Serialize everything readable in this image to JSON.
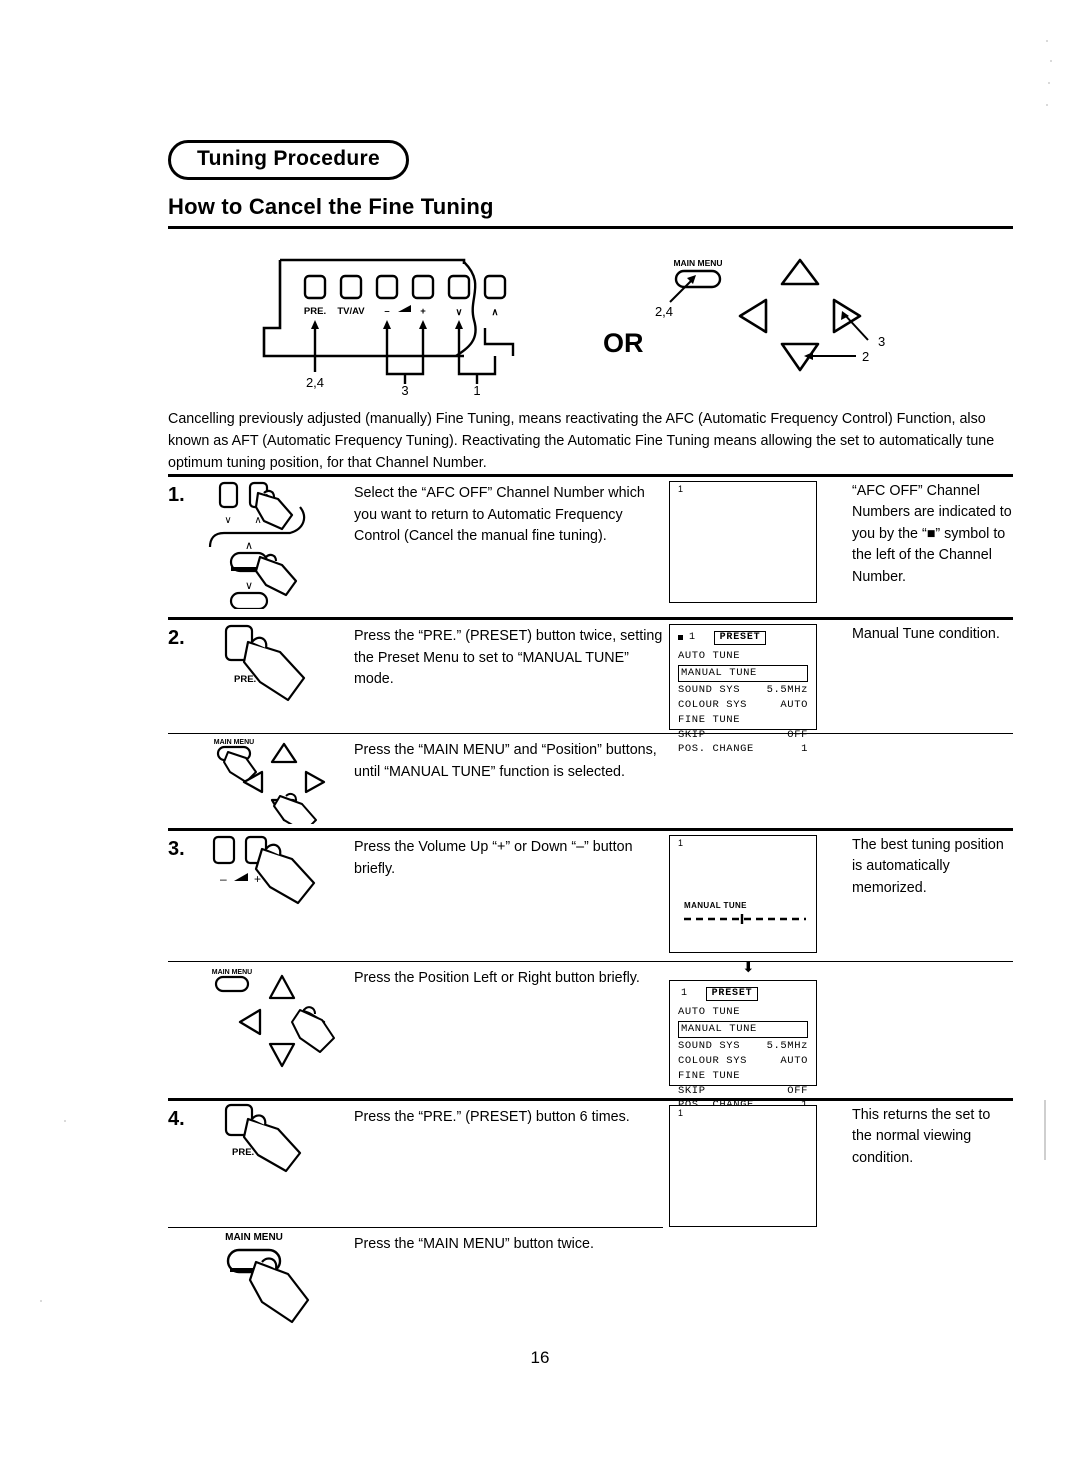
{
  "header": {
    "badge_label": "Tuning Procedure",
    "subtitle": "How to Cancel the Fine Tuning"
  },
  "top_diagram": {
    "tv_panel": {
      "button_labels": [
        "PRE.",
        "TV/AV",
        "–",
        "+",
        "∨",
        "∧"
      ],
      "volume_icon": "volume-wedge-icon",
      "callouts": [
        {
          "label": "2,4",
          "target": "PRE."
        },
        {
          "label": "3",
          "target": "volume - / +"
        },
        {
          "label": "1",
          "target": "channel down / up"
        }
      ]
    },
    "or_label": "OR",
    "remote": {
      "main_menu_label": "MAIN MENU",
      "callouts": [
        {
          "label": "2,4",
          "target": "MAIN MENU button"
        },
        {
          "label": "3",
          "target": "position right button"
        },
        {
          "label": "2",
          "target": "position down button"
        }
      ]
    }
  },
  "intro": {
    "paragraph": "Cancelling previously adjusted (manually) Fine Tuning, means reactivating the AFC (Automatic Frequency Control) Function, also known as AFT (Automatic Frequency Tuning). Reactivating the Automatic Fine Tuning means allowing the set to automatically tune optimum tuning position, for that Channel Number."
  },
  "steps": [
    {
      "number": "1.",
      "icon": "tv-channel-buttons-with-hand-icon",
      "instruction": "Select the “AFC OFF” Channel Number which you want to return to Automatic Frequency Control (Cancel the manual fine tuning).",
      "screen": {
        "type": "blank",
        "channel": "1"
      },
      "note": "“AFC OFF” Channel Numbers are indicated to you by the “■” symbol to the left of the Channel Number."
    },
    {
      "number": "2.",
      "icon": "pre-button-with-hand-icon",
      "icon_label": "PRE.",
      "instruction": "Press the “PRE.” (PRESET) button twice, setting the Preset Menu to set to “MANUAL TUNE” mode.",
      "screen": {
        "type": "osd",
        "channel": "1",
        "afc_marker": true,
        "title": "PRESET",
        "rows": [
          {
            "label": "AUTO TUNE",
            "value": "",
            "selected": false
          },
          {
            "label": "MANUAL TUNE",
            "value": "",
            "selected": true
          },
          {
            "label": "SOUND SYS",
            "value": "5.5MHz",
            "selected": false
          },
          {
            "label": "COLOUR SYS",
            "value": "AUTO",
            "selected": false
          },
          {
            "label": "FINE TUNE",
            "value": "",
            "selected": false
          },
          {
            "label": "SKIP",
            "value": "OFF",
            "selected": false
          },
          {
            "label": "POS. CHANGE",
            "value": "1",
            "selected": false
          }
        ]
      },
      "note": "Manual Tune condition."
    },
    {
      "number": "",
      "icon": "remote-main-menu-position-cluster-icon",
      "icon_label": "MAIN MENU",
      "instruction": "Press the “MAIN MENU” and “Position” buttons, until “MANUAL TUNE” function is selected.",
      "screen": null,
      "note": ""
    },
    {
      "number": "3.",
      "icon": "volume-buttons-with-hand-icon",
      "icon_label": "–   ◢   +",
      "instruction": "Press the Volume Up “+” or Down “–” button briefly.",
      "screen": {
        "type": "manual-tune-bar",
        "channel": "1",
        "bar_label": "MANUAL TUNE"
      },
      "note": "The best tuning position is automatically memorized."
    },
    {
      "number": "",
      "icon": "remote-position-left-right-cluster-icon",
      "icon_label": "MAIN MENU",
      "instruction": "Press the Position Left or Right button briefly.",
      "screen": {
        "type": "osd",
        "channel": "1",
        "afc_marker": false,
        "title": "PRESET",
        "rows": [
          {
            "label": "AUTO TUNE",
            "value": "",
            "selected": false
          },
          {
            "label": "MANUAL TUNE",
            "value": "",
            "selected": true
          },
          {
            "label": "SOUND SYS",
            "value": "5.5MHz",
            "selected": false
          },
          {
            "label": "COLOUR SYS",
            "value": "AUTO",
            "selected": false
          },
          {
            "label": "FINE TUNE",
            "value": "",
            "selected": false
          },
          {
            "label": "SKIP",
            "value": "OFF",
            "selected": false
          },
          {
            "label": "POS. CHANGE",
            "value": "1",
            "selected": false
          }
        ]
      },
      "note": ""
    },
    {
      "number": "4.",
      "icon": "pre-button-with-hand-icon",
      "icon_label": "PRE.",
      "instruction": "Press the “PRE.” (PRESET) button 6 times.",
      "screen": {
        "type": "blank",
        "channel": "1"
      },
      "note": "This returns the set to the normal viewing condition."
    },
    {
      "number": "",
      "icon": "main-menu-button-with-hand-icon",
      "icon_label": "MAIN MENU",
      "instruction": "Press the “MAIN MENU” button twice.",
      "screen": null,
      "note": ""
    }
  ],
  "footer": {
    "page_number": "16"
  }
}
